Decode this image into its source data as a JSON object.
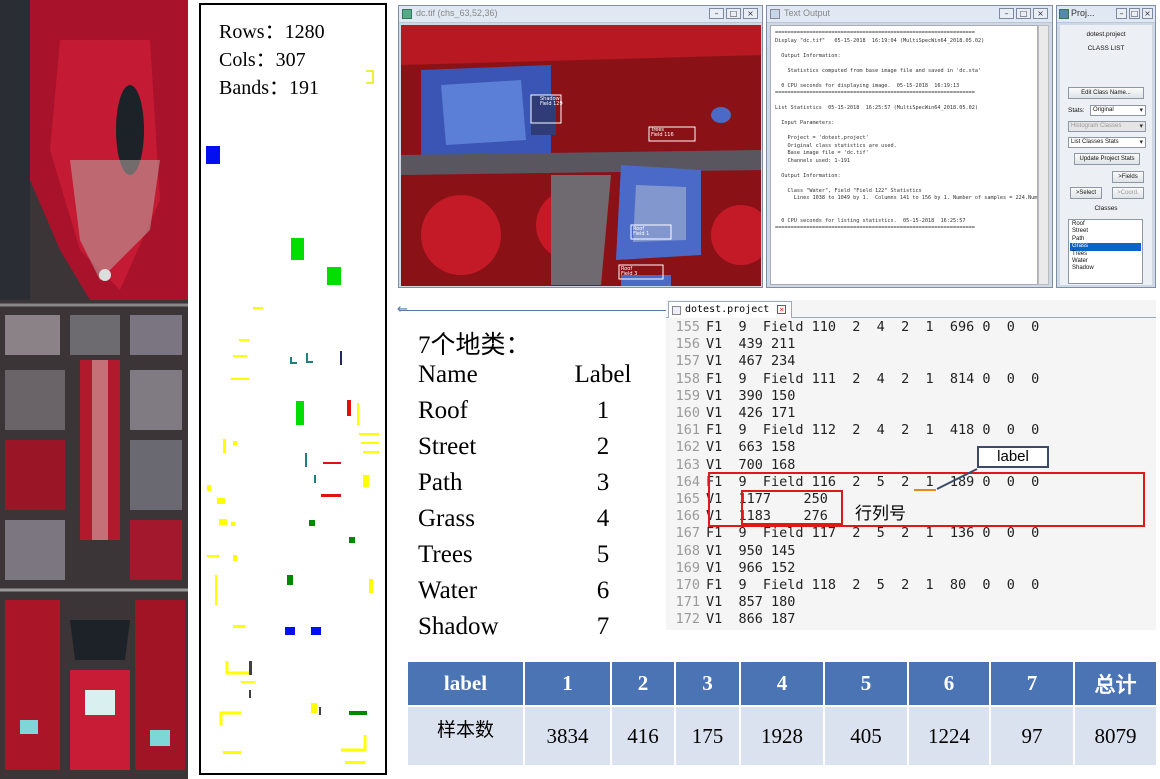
{
  "label_map": {
    "rows": "Rows：1280",
    "cols": "Cols：307",
    "bands": "Bands：191"
  },
  "image_window": {
    "title": "dc.tif (chs_63,52,36)",
    "roi_labels": [
      "Trees",
      "Field 116",
      "Shadow",
      "Field 129",
      "Roof",
      "Field 1",
      "Roof",
      "Field 3"
    ]
  },
  "text_output": {
    "title": "Text Output",
    "lines": [
      "================================================================",
      "Display \"dc.tif\"   05-15-2018  16:19:04 (MultiSpecWin64_2018.05.02)",
      "",
      "  Output Information:",
      "",
      "    Statistics computed from base image file and saved in 'dc.sta'",
      "",
      "  0 CPU seconds for displaying image.  05-15-2018  16:19:13",
      "================================================================",
      "",
      "List Statistics  05-15-2018  16:25:57 (MultiSpecWin64_2018.05.02)",
      "",
      "  Input Parameters:",
      "",
      "    Project = 'dotest.project'",
      "    Original class statistics are used.",
      "    Base image file = 'dc.tif'",
      "    Channels used: 1-191",
      "",
      "  Output Information:",
      "",
      "    Class \"Water\", Field \"Field 122\" Statistics",
      "      Lines 1038 to 1049 by 1.  Columns 141 to 156 by 1. Number of samples = 224.Number of s",
      "",
      "",
      "  0 CPU seconds for listing statistics.  05-15-2018  16:25:57",
      "================================================================"
    ]
  },
  "project_window": {
    "title": "Proj...",
    "project_name": "dotest.project",
    "heading": "CLASS LIST",
    "edit_class_name": "Edit Class Name...",
    "stats_label": "Stats:",
    "stats_value": "Original",
    "histogram_classes": "Histogram Classes",
    "list_classes_stats": "List Classes Stats",
    "update_project_stats": "Update Project Stats",
    "fields_button": ">Fields",
    "select_button": ">Select",
    "coord_button": ">Coord.",
    "classes_label": "Classes",
    "classes": [
      "Roof",
      "Street",
      "Path",
      "Grass",
      "Trees",
      "Water",
      "Shadow"
    ],
    "selected_class": "Grass"
  },
  "class_legend": {
    "heading": "7个地类：",
    "col_name": "Name",
    "col_label": "Label",
    "rows": [
      {
        "name": "Roof",
        "label": "1"
      },
      {
        "name": "Street",
        "label": "2"
      },
      {
        "name": "Path",
        "label": "3"
      },
      {
        "name": "Grass",
        "label": "4"
      },
      {
        "name": "Trees",
        "label": "5"
      },
      {
        "name": "Water",
        "label": "6"
      },
      {
        "name": "Shadow",
        "label": "7"
      }
    ]
  },
  "editor": {
    "tab_name": "dotest.project",
    "lines": [
      {
        "n": "155",
        "t": "F1  9  Field 110  2  4  2  1  696 0  0  0"
      },
      {
        "n": "156",
        "t": "V1  439 211"
      },
      {
        "n": "157",
        "t": "V1  467 234"
      },
      {
        "n": "158",
        "t": "F1  9  Field 111  2  4  2  1  814 0  0  0"
      },
      {
        "n": "159",
        "t": "V1  390 150"
      },
      {
        "n": "160",
        "t": "V1  426 171"
      },
      {
        "n": "161",
        "t": "F1  9  Field 112  2  4  2  1  418 0  0  0"
      },
      {
        "n": "162",
        "t": "V1  663 158"
      },
      {
        "n": "163",
        "t": "V1  700 168"
      },
      {
        "n": "164",
        "t": "F1  9  Field 116  2  5  2  1  189 0  0  0"
      },
      {
        "n": "165",
        "t": "V1  1177    250"
      },
      {
        "n": "166",
        "t": "V1  1183    276"
      },
      {
        "n": "167",
        "t": "F1  9  Field 117  2  5  2  1  136 0  0  0"
      },
      {
        "n": "168",
        "t": "V1  950 145"
      },
      {
        "n": "169",
        "t": "V1  966 152"
      },
      {
        "n": "170",
        "t": "F1  9  Field 118  2  5  2  1  80  0  0  0"
      },
      {
        "n": "171",
        "t": "V1  857 180"
      },
      {
        "n": "172",
        "t": "V1  866 187"
      }
    ],
    "callout_label": "label",
    "row_col_note": "行列号"
  },
  "summary_table": {
    "header": [
      "label",
      "1",
      "2",
      "3",
      "4",
      "5",
      "6",
      "7",
      "总计"
    ],
    "row": [
      "样本数",
      "3834",
      "416",
      "175",
      "1928",
      "405",
      "1224",
      "97",
      "8079"
    ]
  },
  "colors": {
    "table_header": "#4a74b4",
    "table_body": "#dbe2ef",
    "highlight": "#e01818",
    "veg_red": "#c8102e"
  }
}
